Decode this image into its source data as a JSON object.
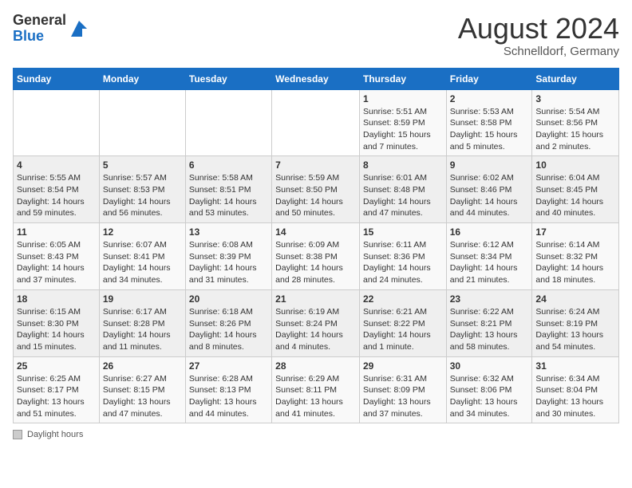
{
  "header": {
    "logo_general": "General",
    "logo_blue": "Blue",
    "month_year": "August 2024",
    "location": "Schnelldorf, Germany"
  },
  "days_of_week": [
    "Sunday",
    "Monday",
    "Tuesday",
    "Wednesday",
    "Thursday",
    "Friday",
    "Saturday"
  ],
  "weeks": [
    [
      {
        "num": "",
        "info": ""
      },
      {
        "num": "",
        "info": ""
      },
      {
        "num": "",
        "info": ""
      },
      {
        "num": "",
        "info": ""
      },
      {
        "num": "1",
        "info": "Sunrise: 5:51 AM\nSunset: 8:59 PM\nDaylight: 15 hours\nand 7 minutes."
      },
      {
        "num": "2",
        "info": "Sunrise: 5:53 AM\nSunset: 8:58 PM\nDaylight: 15 hours\nand 5 minutes."
      },
      {
        "num": "3",
        "info": "Sunrise: 5:54 AM\nSunset: 8:56 PM\nDaylight: 15 hours\nand 2 minutes."
      }
    ],
    [
      {
        "num": "4",
        "info": "Sunrise: 5:55 AM\nSunset: 8:54 PM\nDaylight: 14 hours\nand 59 minutes."
      },
      {
        "num": "5",
        "info": "Sunrise: 5:57 AM\nSunset: 8:53 PM\nDaylight: 14 hours\nand 56 minutes."
      },
      {
        "num": "6",
        "info": "Sunrise: 5:58 AM\nSunset: 8:51 PM\nDaylight: 14 hours\nand 53 minutes."
      },
      {
        "num": "7",
        "info": "Sunrise: 5:59 AM\nSunset: 8:50 PM\nDaylight: 14 hours\nand 50 minutes."
      },
      {
        "num": "8",
        "info": "Sunrise: 6:01 AM\nSunset: 8:48 PM\nDaylight: 14 hours\nand 47 minutes."
      },
      {
        "num": "9",
        "info": "Sunrise: 6:02 AM\nSunset: 8:46 PM\nDaylight: 14 hours\nand 44 minutes."
      },
      {
        "num": "10",
        "info": "Sunrise: 6:04 AM\nSunset: 8:45 PM\nDaylight: 14 hours\nand 40 minutes."
      }
    ],
    [
      {
        "num": "11",
        "info": "Sunrise: 6:05 AM\nSunset: 8:43 PM\nDaylight: 14 hours\nand 37 minutes."
      },
      {
        "num": "12",
        "info": "Sunrise: 6:07 AM\nSunset: 8:41 PM\nDaylight: 14 hours\nand 34 minutes."
      },
      {
        "num": "13",
        "info": "Sunrise: 6:08 AM\nSunset: 8:39 PM\nDaylight: 14 hours\nand 31 minutes."
      },
      {
        "num": "14",
        "info": "Sunrise: 6:09 AM\nSunset: 8:38 PM\nDaylight: 14 hours\nand 28 minutes."
      },
      {
        "num": "15",
        "info": "Sunrise: 6:11 AM\nSunset: 8:36 PM\nDaylight: 14 hours\nand 24 minutes."
      },
      {
        "num": "16",
        "info": "Sunrise: 6:12 AM\nSunset: 8:34 PM\nDaylight: 14 hours\nand 21 minutes."
      },
      {
        "num": "17",
        "info": "Sunrise: 6:14 AM\nSunset: 8:32 PM\nDaylight: 14 hours\nand 18 minutes."
      }
    ],
    [
      {
        "num": "18",
        "info": "Sunrise: 6:15 AM\nSunset: 8:30 PM\nDaylight: 14 hours\nand 15 minutes."
      },
      {
        "num": "19",
        "info": "Sunrise: 6:17 AM\nSunset: 8:28 PM\nDaylight: 14 hours\nand 11 minutes."
      },
      {
        "num": "20",
        "info": "Sunrise: 6:18 AM\nSunset: 8:26 PM\nDaylight: 14 hours\nand 8 minutes."
      },
      {
        "num": "21",
        "info": "Sunrise: 6:19 AM\nSunset: 8:24 PM\nDaylight: 14 hours\nand 4 minutes."
      },
      {
        "num": "22",
        "info": "Sunrise: 6:21 AM\nSunset: 8:22 PM\nDaylight: 14 hours\nand 1 minute."
      },
      {
        "num": "23",
        "info": "Sunrise: 6:22 AM\nSunset: 8:21 PM\nDaylight: 13 hours\nand 58 minutes."
      },
      {
        "num": "24",
        "info": "Sunrise: 6:24 AM\nSunset: 8:19 PM\nDaylight: 13 hours\nand 54 minutes."
      }
    ],
    [
      {
        "num": "25",
        "info": "Sunrise: 6:25 AM\nSunset: 8:17 PM\nDaylight: 13 hours\nand 51 minutes."
      },
      {
        "num": "26",
        "info": "Sunrise: 6:27 AM\nSunset: 8:15 PM\nDaylight: 13 hours\nand 47 minutes."
      },
      {
        "num": "27",
        "info": "Sunrise: 6:28 AM\nSunset: 8:13 PM\nDaylight: 13 hours\nand 44 minutes."
      },
      {
        "num": "28",
        "info": "Sunrise: 6:29 AM\nSunset: 8:11 PM\nDaylight: 13 hours\nand 41 minutes."
      },
      {
        "num": "29",
        "info": "Sunrise: 6:31 AM\nSunset: 8:09 PM\nDaylight: 13 hours\nand 37 minutes."
      },
      {
        "num": "30",
        "info": "Sunrise: 6:32 AM\nSunset: 8:06 PM\nDaylight: 13 hours\nand 34 minutes."
      },
      {
        "num": "31",
        "info": "Sunrise: 6:34 AM\nSunset: 8:04 PM\nDaylight: 13 hours\nand 30 minutes."
      }
    ]
  ],
  "footer": {
    "daylight_label": "Daylight hours"
  }
}
